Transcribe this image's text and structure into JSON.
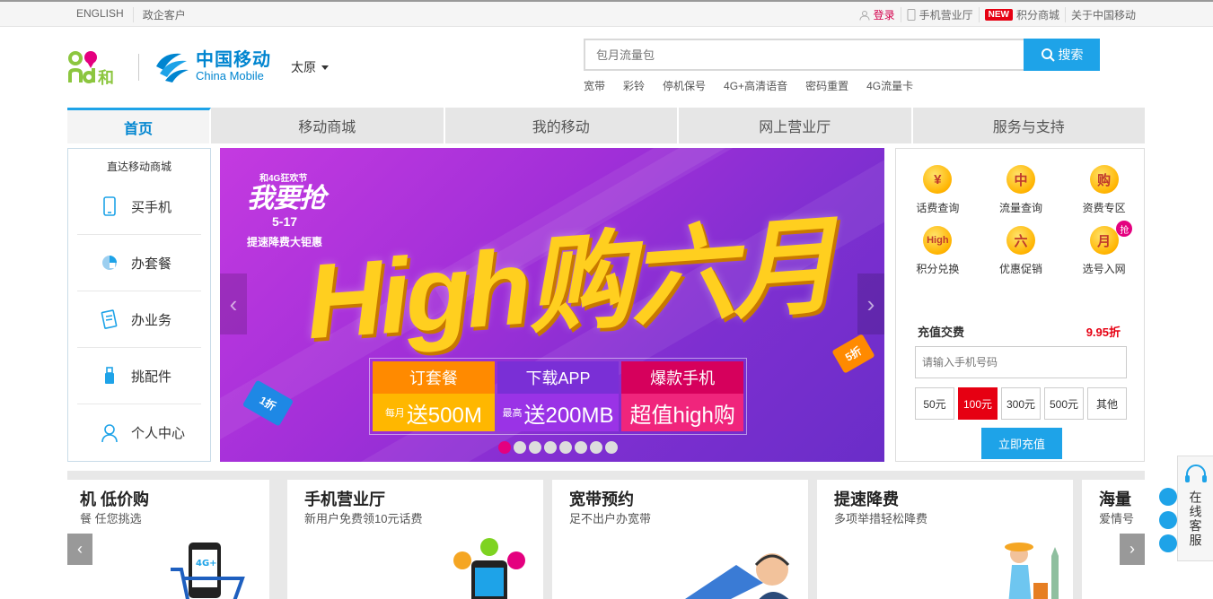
{
  "topbar": {
    "left": [
      "ENGLISH",
      "政企客户"
    ],
    "login": "登录",
    "phone_hall": "手机营业厅",
    "new_badge": "NEW",
    "points_mall": "积分商城",
    "about": "关于中国移动"
  },
  "header": {
    "logo_and": "and和",
    "logo_cn": "中国移动",
    "logo_en": "China Mobile",
    "city": "太原",
    "search_placeholder": "包月流量包",
    "search_button": "搜索",
    "hotwords": [
      "宽带",
      "彩铃",
      "停机保号",
      "4G+高清语音",
      "密码重置",
      "4G流量卡"
    ]
  },
  "nav": {
    "tabs": [
      "首页",
      "移动商城",
      "我的移动",
      "网上营业厅",
      "服务与支持"
    ]
  },
  "leftmenu": {
    "title": "直达移动商城",
    "items": [
      {
        "label": "买手机",
        "icon": "phone-icon"
      },
      {
        "label": "办套餐",
        "icon": "package-icon"
      },
      {
        "label": "办业务",
        "icon": "document-icon"
      },
      {
        "label": "挑配件",
        "icon": "usb-icon"
      },
      {
        "label": "个人中心",
        "icon": "user-icon"
      }
    ]
  },
  "banner": {
    "fest_small": "和4G狂欢节",
    "fest_big": "我要抢",
    "date": "5-17",
    "sub": "提速降费大钜惠",
    "headline": "High购六月",
    "badge_left": "1折",
    "badge_right": "5折",
    "offers": [
      {
        "top": "订套餐",
        "prefix": "每月",
        "bottom": "送500M"
      },
      {
        "top": "下载APP",
        "prefix": "最高",
        "bottom": "送200MB"
      },
      {
        "top": "爆款手机",
        "prefix": "",
        "bottom": "超值high购"
      }
    ],
    "dot_count": 8,
    "active_dot": 0
  },
  "quick": {
    "items": [
      {
        "label": "话费查询",
        "glyph": "¥"
      },
      {
        "label": "流量查询",
        "glyph": "中"
      },
      {
        "label": "资费专区",
        "glyph": "购"
      },
      {
        "label": "积分兑换",
        "glyph": "High"
      },
      {
        "label": "优惠促销",
        "glyph": "六"
      },
      {
        "label": "选号入网",
        "glyph": "月"
      }
    ],
    "hot_tag": "抢"
  },
  "recharge": {
    "title": "充值交费",
    "discount": "9.95折",
    "input_placeholder": "请输入手机号码",
    "amounts": [
      "50元",
      "100元",
      "300元",
      "500元",
      "其他"
    ],
    "selected": "100元",
    "button": "立即充值"
  },
  "cards": [
    {
      "title": "机 低价购",
      "subtitle": "餐 任您挑选"
    },
    {
      "title": "手机营业厅",
      "subtitle": "新用户免费领10元话费"
    },
    {
      "title": "宽带预约",
      "subtitle": "足不出户办宽带"
    },
    {
      "title": "提速降费",
      "subtitle": "多项举措轻松降费"
    },
    {
      "title": "海量",
      "subtitle": "爱情号"
    }
  ],
  "service": {
    "label": "在线客服"
  },
  "colors": {
    "brand_blue": "#0085d0",
    "button_blue": "#1ea3e8",
    "accent_red": "#e60012",
    "accent_pink": "#e4007f"
  }
}
